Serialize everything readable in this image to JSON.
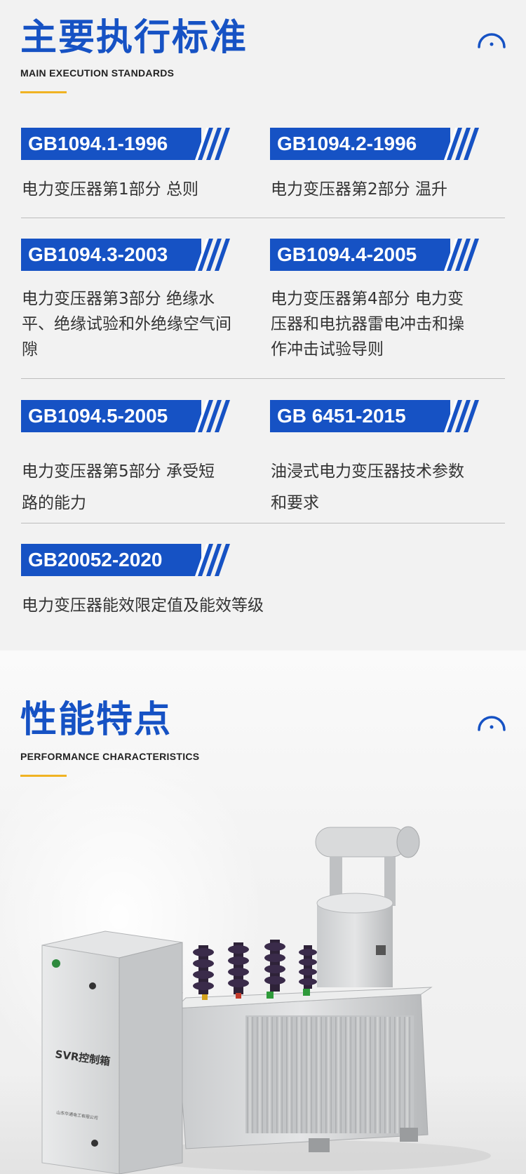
{
  "standards_section": {
    "title": "主要执行标准",
    "subtitle": "MAIN EXECUTION STANDARDS",
    "items": [
      {
        "code": "GB1094.1-1996",
        "desc": [
          "电力变压器第1部分 总则"
        ]
      },
      {
        "code": "GB1094.2-1996",
        "desc": [
          "电力变压器第2部分 温升"
        ]
      },
      {
        "code": "GB1094.3-2003",
        "desc": [
          "电力变压器第3部分 绝缘水",
          "平、绝缘试验和外绝缘空气间",
          "隙"
        ]
      },
      {
        "code": "GB1094.4-2005",
        "desc": [
          "电力变压器第4部分 电力变",
          "压器和电抗器雷电冲击和操",
          "作冲击试验导则"
        ]
      },
      {
        "code": "GB1094.5-2005",
        "desc": [
          "电力变压器第5部分 承受短",
          "路的能力"
        ]
      },
      {
        "code": "GB 6451-2015",
        "desc": [
          "油浸式电力变压器技术参数",
          "和要求"
        ]
      },
      {
        "code": "GB20052-2020",
        "desc": [
          "电力变压器能效限定值及能效等级"
        ]
      }
    ]
  },
  "performance_section": {
    "title": "性能特点",
    "subtitle": "PERFORMANCE CHARACTERISTICS",
    "product_image": {
      "cabinet_label": "SVR控制箱",
      "cabinet_small_text": "山东华通电工有限公司"
    }
  },
  "colors": {
    "accent": "#1652c4",
    "gold_line": "#f0b323",
    "text": "#333333",
    "bg": "#f2f2f2"
  },
  "icons": {
    "corner_decoration": "arc-dot-icon"
  }
}
